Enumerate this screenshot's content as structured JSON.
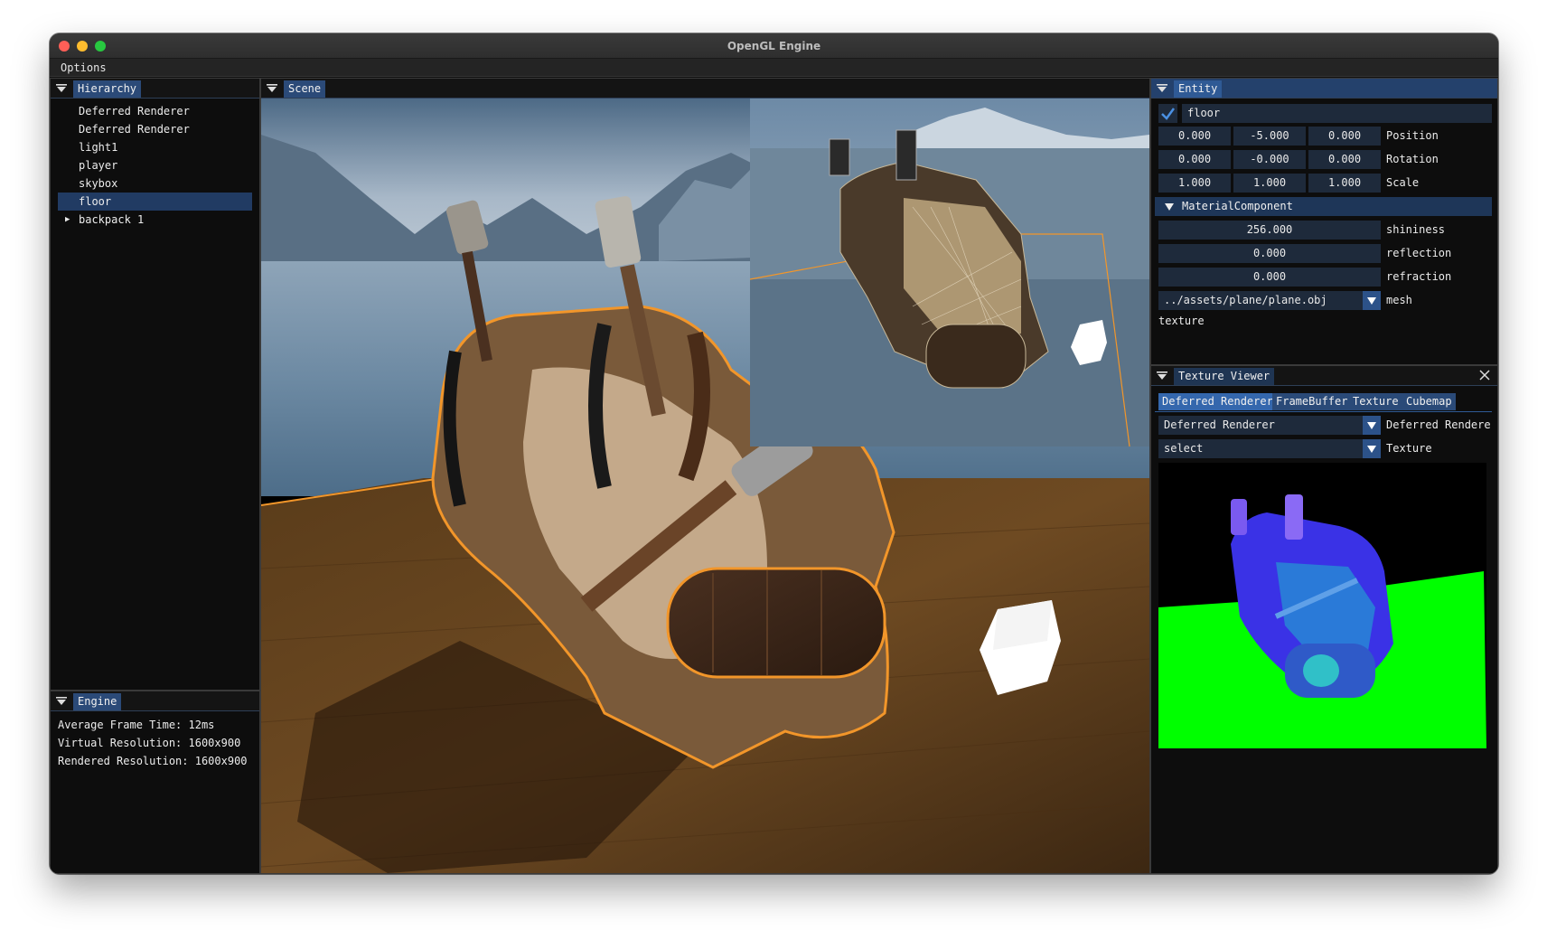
{
  "window": {
    "title": "OpenGL Engine"
  },
  "menu": {
    "options": "Options"
  },
  "hierarchy": {
    "tab": "Hierarchy",
    "items": [
      {
        "label": "Deferred Renderer"
      },
      {
        "label": "Deferred Renderer"
      },
      {
        "label": "light1"
      },
      {
        "label": "player"
      },
      {
        "label": "skybox"
      },
      {
        "label": "floor"
      },
      {
        "label": "backpack 1"
      }
    ],
    "selected": "floor"
  },
  "engine": {
    "tab": "Engine",
    "frame_time": "Average Frame Time: 12ms",
    "virtual_res": "Virtual Resolution: 1600x900",
    "rendered_res": "Rendered Resolution: 1600x900"
  },
  "scene": {
    "tab": "Scene"
  },
  "entity": {
    "tab": "Entity",
    "name": "floor",
    "enabled": true,
    "position": [
      "0.000",
      "-5.000",
      "0.000"
    ],
    "position_label": "Position",
    "rotation": [
      "0.000",
      "-0.000",
      "0.000"
    ],
    "rotation_label": "Rotation",
    "scale": [
      "1.000",
      "1.000",
      "1.000"
    ],
    "scale_label": "Scale",
    "material": {
      "header": "MaterialComponent",
      "shininess": "256.000",
      "shininess_label": "shininess",
      "reflection": "0.000",
      "reflection_label": "reflection",
      "refraction": "0.000",
      "refraction_label": "refraction",
      "mesh": "../assets/plane/plane.obj",
      "mesh_label": "mesh",
      "texture_label": "texture"
    }
  },
  "texture_viewer": {
    "tab": "Texture Viewer",
    "tabs": [
      "Deferred Renderer",
      "FrameBuffer",
      "Texture",
      "Cubemap"
    ],
    "active_tab": "Deferred Renderer",
    "renderer_select": "Deferred Renderer",
    "renderer_label": "Deferred Rendere",
    "texture_select": "select",
    "texture_label": "Texture"
  },
  "colors": {
    "accent": "#2f5a95",
    "selection_outline": "#f2962a",
    "normal_map_floor": "#00ff00"
  }
}
